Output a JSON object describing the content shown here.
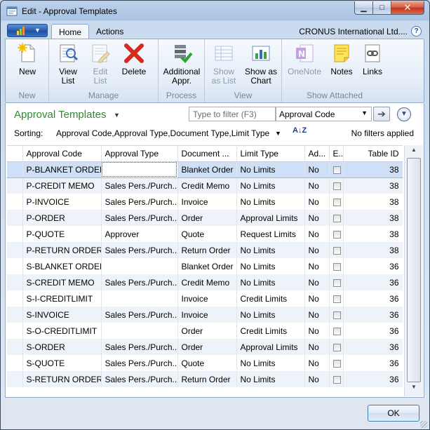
{
  "window": {
    "title": "Edit - Approval Templates"
  },
  "ribbon_tabs": [
    "Home",
    "Actions"
  ],
  "company": "CRONUS International Ltd....",
  "groups": {
    "new": {
      "label": "New",
      "buttons": [
        {
          "label": "New"
        }
      ]
    },
    "manage": {
      "label": "Manage",
      "buttons": [
        {
          "label": "View\nList"
        },
        {
          "label": "Edit\nList"
        },
        {
          "label": "Delete"
        }
      ]
    },
    "process": {
      "label": "Process",
      "buttons": [
        {
          "label": "Additional\nAppr."
        }
      ]
    },
    "view": {
      "label": "View",
      "buttons": [
        {
          "label": "Show\nas List"
        },
        {
          "label": "Show as\nChart"
        }
      ]
    },
    "attached": {
      "label": "Show Attached",
      "buttons": [
        {
          "label": "OneNote"
        },
        {
          "label": "Notes"
        },
        {
          "label": "Links"
        }
      ]
    }
  },
  "list": {
    "title": "Approval Templates",
    "filter_placeholder": "Type to filter (F3)",
    "filter_field": "Approval Code",
    "sorting_label": "Sorting:",
    "sorting_value": "Approval Code,Approval Type,Document Type,Limit Type",
    "filters_status": "No filters applied"
  },
  "columns": [
    "Approval Code",
    "Approval Type",
    "Document ...",
    "Limit Type",
    "Ad...",
    "E...",
    "Table ID"
  ],
  "rows": [
    [
      "P-BLANKET ORDER",
      "",
      "Blanket Order",
      "No Limits",
      "No",
      false,
      "38"
    ],
    [
      "P-CREDIT MEMO",
      "Sales Pers./Purch...",
      "Credit Memo",
      "No Limits",
      "No",
      false,
      "38"
    ],
    [
      "P-INVOICE",
      "Sales Pers./Purch...",
      "Invoice",
      "No Limits",
      "No",
      false,
      "38"
    ],
    [
      "P-ORDER",
      "Sales Pers./Purch...",
      "Order",
      "Approval Limits",
      "No",
      false,
      "38"
    ],
    [
      "P-QUOTE",
      "Approver",
      "Quote",
      "Request Limits",
      "No",
      false,
      "38"
    ],
    [
      "P-RETURN ORDER",
      "Sales Pers./Purch...",
      "Return Order",
      "No Limits",
      "No",
      false,
      "38"
    ],
    [
      "S-BLANKET ORDER",
      "",
      "Blanket Order",
      "No Limits",
      "No",
      false,
      "36"
    ],
    [
      "S-CREDIT MEMO",
      "Sales Pers./Purch...",
      "Credit Memo",
      "No Limits",
      "No",
      false,
      "36"
    ],
    [
      "S-I-CREDITLIMIT",
      "",
      "Invoice",
      "Credit Limits",
      "No",
      false,
      "36"
    ],
    [
      "S-INVOICE",
      "Sales Pers./Purch...",
      "Invoice",
      "No Limits",
      "No",
      false,
      "36"
    ],
    [
      "S-O-CREDITLIMIT",
      "",
      "Order",
      "Credit Limits",
      "No",
      false,
      "36"
    ],
    [
      "S-ORDER",
      "Sales Pers./Purch...",
      "Order",
      "Approval Limits",
      "No",
      false,
      "36"
    ],
    [
      "S-QUOTE",
      "Sales Pers./Purch...",
      "Quote",
      "No Limits",
      "No",
      false,
      "36"
    ],
    [
      "S-RETURN ORDER",
      "Sales Pers./Purch...",
      "Return Order",
      "No Limits",
      "No",
      false,
      "36"
    ]
  ],
  "ok_label": "OK"
}
